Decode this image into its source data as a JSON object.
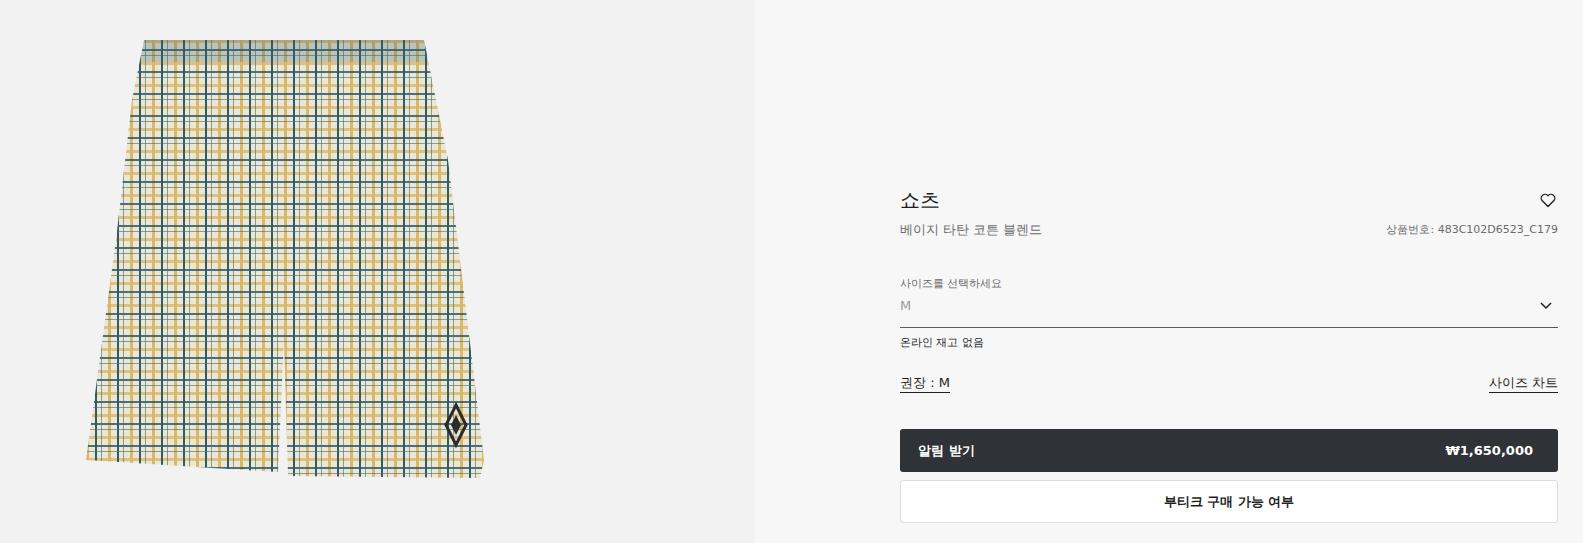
{
  "product": {
    "title": "쇼츠",
    "subtitle": "베이지 타탄 코튼 블렌드",
    "sku": "상품번호: 483C102D6523_C179",
    "favorite": false
  },
  "size_select": {
    "label": "사이즈를 선택하세요",
    "value": "M"
  },
  "stock_note": "온라인 재고 없음",
  "recommended": "권장 : M",
  "size_chart": "사이즈 차트",
  "notify_button": {
    "label": "알림 받기",
    "price": "₩1,650,000"
  },
  "boutique_button": "부티크 구매 가능 여부"
}
